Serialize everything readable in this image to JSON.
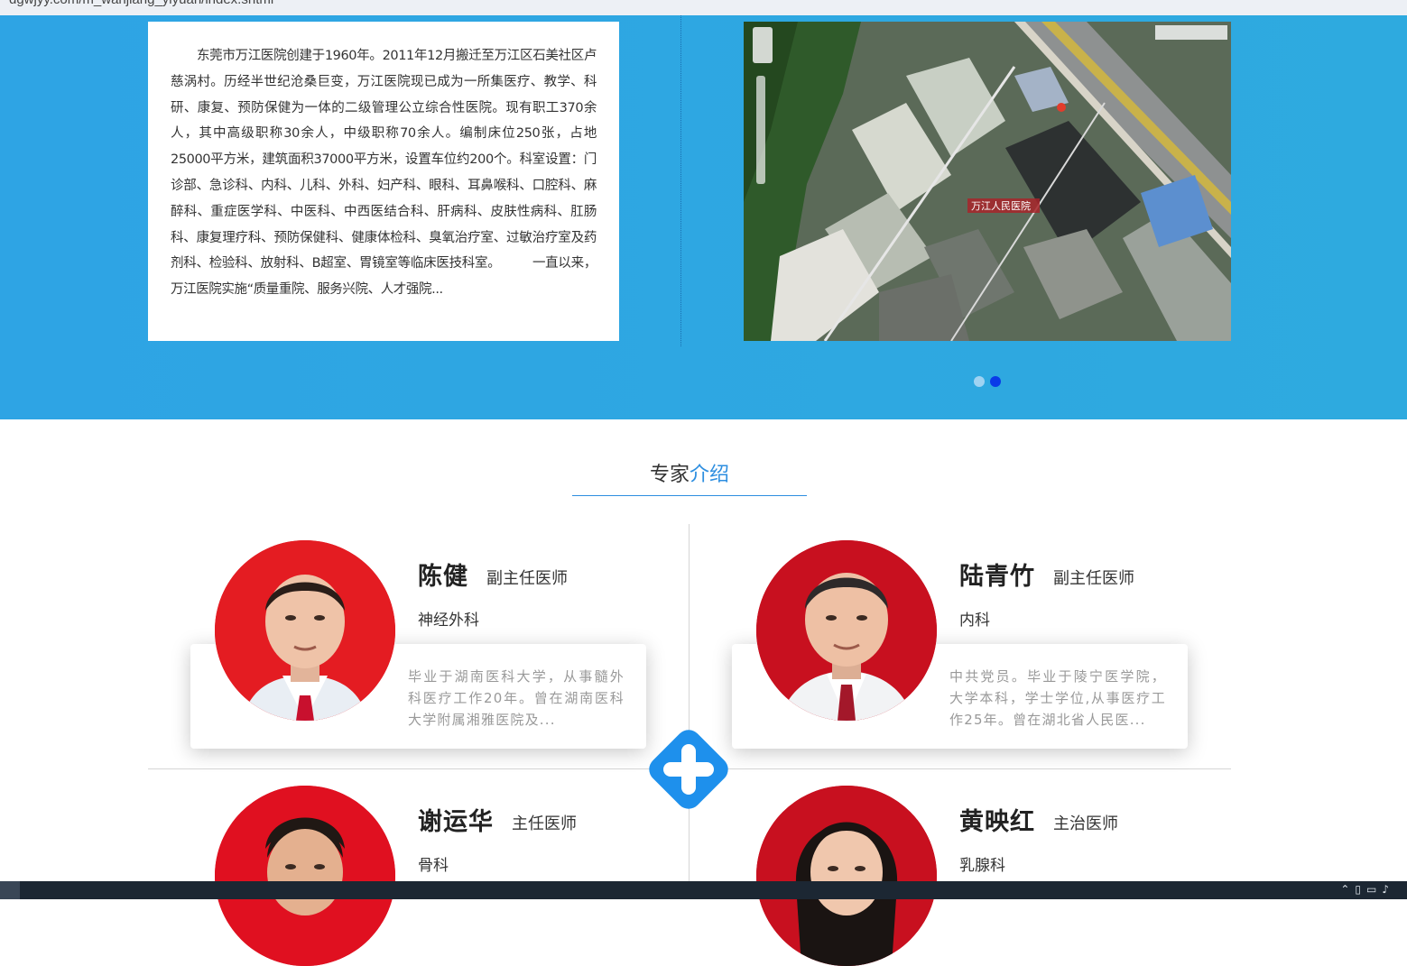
{
  "browser": {
    "url": "dgwjyy.com/m_wanjiang_yiyuan/index.shtml"
  },
  "intro": {
    "text": "东莞市万江医院创建于1960年。2011年12月搬迁至万江区石美社区卢慈涡村。历经半世纪沧桑巨变，万江医院现已成为一所集医疗、教学、科研、康复、预防保健为一体的二级管理公立综合性医院。现有职工370余人，其中高级职称30余人，中级职称70余人。编制床位250张，占地25000平方米，建筑面积37000平方米，设置车位约200个。科室设置：门诊部、急诊科、内科、儿科、外科、妇产科、眼科、耳鼻喉科、口腔科、麻醉科、重症医学科、中医科、中西医结合科、肝病科、皮肤性病科、肛肠科、康复理疗科、预防保健科、健康体检科、臭氧治疗室、过敏治疗室及药剂科、检验科、放射科、B超室、胃镜室等临床医技科室。　　　一直以来，万江医院实施“质量重院、服务兴院、人才强院..."
  },
  "map": {
    "label": "万江人民医院"
  },
  "carousel": {
    "active_index": 1,
    "count": 2
  },
  "experts": {
    "title_main": "专家",
    "title_accent": "介绍",
    "doctors": [
      {
        "name": "陈健",
        "title": "副主任医师",
        "dept": "神经外科",
        "desc": "毕业于湖南医科大学，从事髓外科医疗工作20年。曾在湖南医科大学附属湘雅医院及..."
      },
      {
        "name": "陆青竹",
        "title": "副主任医师",
        "dept": "内科",
        "desc": "中共党员。毕业于陵宁医学院，大学本科，学士学位,从事医疗工作25年。曾在湖北省人民医..."
      },
      {
        "name": "谢运华",
        "title": "主任医师",
        "dept": "骨科"
      },
      {
        "name": "黄映红",
        "title": "主治医师",
        "dept": "乳腺科"
      }
    ]
  },
  "colors": {
    "hero_bg": "#2ea6e2",
    "accent_blue": "#2d8ee0",
    "carousel_active": "#0a3be8",
    "carousel_inactive": "#9fd3f2",
    "avatar_red": "#e01020",
    "plus_blue": "#1e90ec"
  },
  "icons": {
    "plus": "medical-plus-icon"
  }
}
